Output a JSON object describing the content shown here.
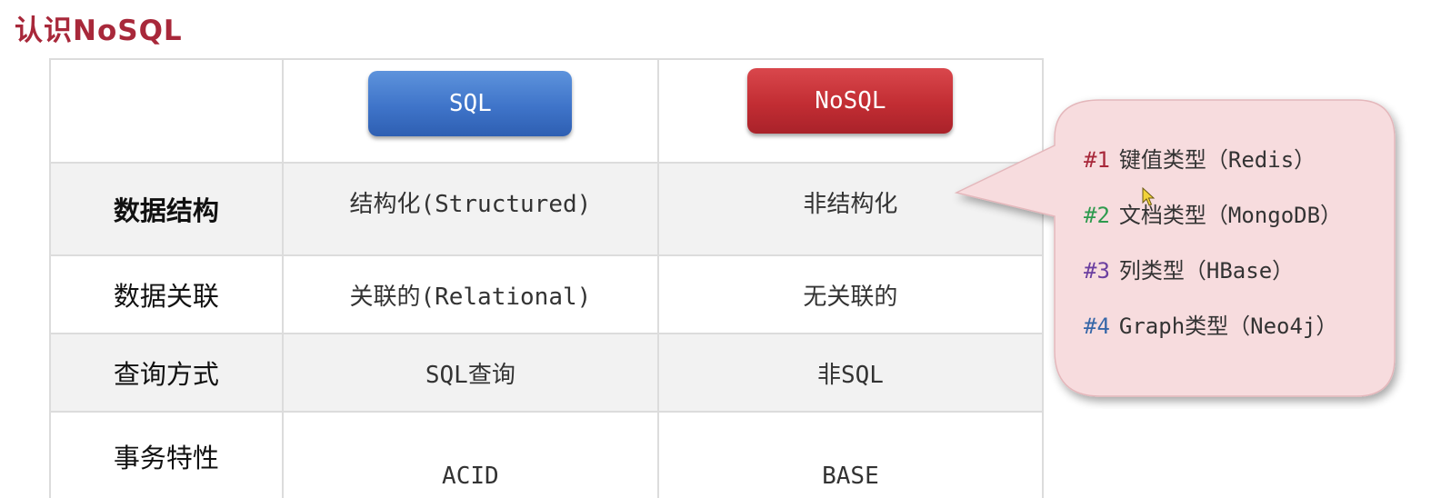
{
  "title": "认识NoSQL",
  "table": {
    "headers": {
      "sql": "SQL",
      "nosql": "NoSQL"
    },
    "colors": {
      "sql_button": "#3f74c9",
      "nosql_button": "#c22d33"
    },
    "rows": [
      {
        "label": "数据结构",
        "sql": "结构化(Structured)",
        "nosql": "非结构化"
      },
      {
        "label": "数据关联",
        "sql": "关联的(Relational)",
        "nosql": "无关联的"
      },
      {
        "label": "查询方式",
        "sql": "SQL查询",
        "nosql": "非SQL"
      },
      {
        "label": "事务特性",
        "sql": "ACID",
        "nosql": "BASE"
      }
    ]
  },
  "callout": {
    "background": "#f7dcde",
    "items": [
      {
        "num": "#1",
        "num_color": "#a8283a",
        "text": "键值类型（Redis）"
      },
      {
        "num": "#2",
        "num_color": "#2e9a4e",
        "text": "文档类型（MongoDB）"
      },
      {
        "num": "#3",
        "num_color": "#6b3fa0",
        "text": "列类型（HBase）"
      },
      {
        "num": "#4",
        "num_color": "#3767a8",
        "text": "Graph类型（Neo4j）"
      }
    ]
  }
}
